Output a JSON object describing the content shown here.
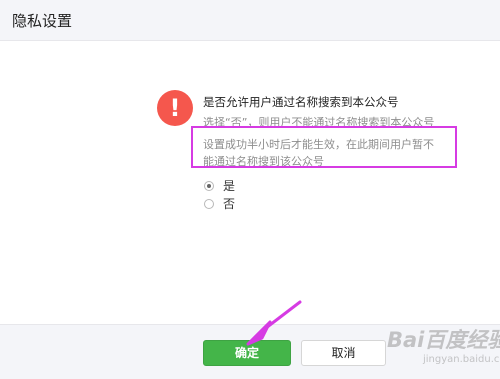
{
  "dialog": {
    "title": "隐私设置"
  },
  "content": {
    "question": "是否允许用户通过名称搜索到本公众号",
    "description_line1": "选择“否”，则用户不能通过名称搜索到本公众号",
    "description_line2": "设置成功半小时后才能生效，在此期间用户暂不",
    "description_line3": "能通过名称搜到该公众号",
    "warning_glyph": "!"
  },
  "options": [
    {
      "label": "是",
      "selected": true
    },
    {
      "label": "否",
      "selected": false
    }
  ],
  "footer": {
    "confirm_label": "确定",
    "cancel_label": "取消"
  },
  "annotations": {
    "highlight_color": "#d63be3",
    "arrow_color": "#d63be3"
  },
  "watermark": {
    "text": "Bai百度经验",
    "sub": "jingyan.baidu.com"
  },
  "colors": {
    "accent_green": "#44b549",
    "warning_red": "#f5574d"
  }
}
